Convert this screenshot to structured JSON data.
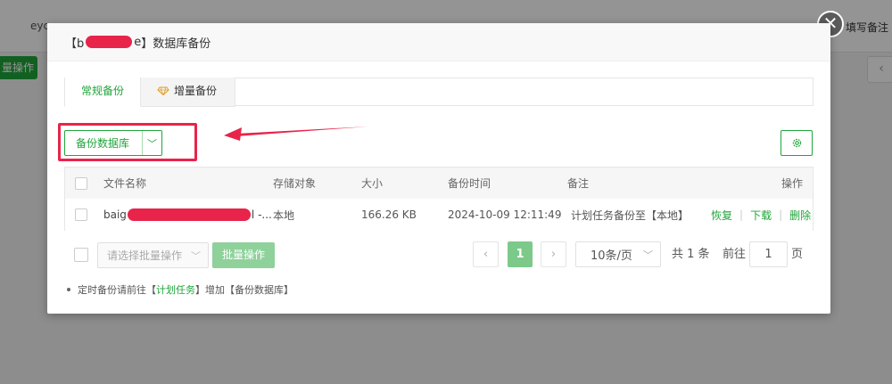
{
  "background": {
    "host_fragment": "eyc",
    "right_text": "填写备注",
    "left_button": "量操作",
    "pager_glyph": "‹"
  },
  "close_glyph": "✕",
  "dialog": {
    "title_prefix": "【b",
    "title_mid": "e",
    "title_suffix": "】数据库备份"
  },
  "tabs": [
    {
      "label": "常规备份",
      "active": true
    },
    {
      "label": "增量备份",
      "active": false,
      "icon": "diamond-icon"
    }
  ],
  "toolbar": {
    "backup_button": "备份数据库",
    "chevron": "﹀",
    "settings_icon": "gear-icon"
  },
  "table": {
    "headers": [
      "文件名称",
      "存储对象",
      "大小",
      "备份时间",
      "备注",
      "操作"
    ],
    "rows": [
      {
        "filename_prefix": "baig",
        "filename_suffix": "l -...",
        "storage": "本地",
        "size": "166.26 KB",
        "time": "2024-10-09 12:11:49",
        "note": "计划任务备份至【本地】",
        "actions": [
          "恢复",
          "下载",
          "删除"
        ]
      }
    ]
  },
  "footer": {
    "batch_placeholder": "请选择批量操作",
    "batch_button": "批量操作",
    "prev": "‹",
    "current_page": "1",
    "next": "›",
    "per_page": "10条/页",
    "total": "共 1 条",
    "goto_label": "前往",
    "goto_value": "1",
    "page_label": "页"
  },
  "tip": {
    "before": "定时备份请前往【",
    "link": "计划任务",
    "after": "】增加【备份数据库】"
  },
  "colors": {
    "accent": "#20a53a",
    "annotation": "#e8244a"
  }
}
